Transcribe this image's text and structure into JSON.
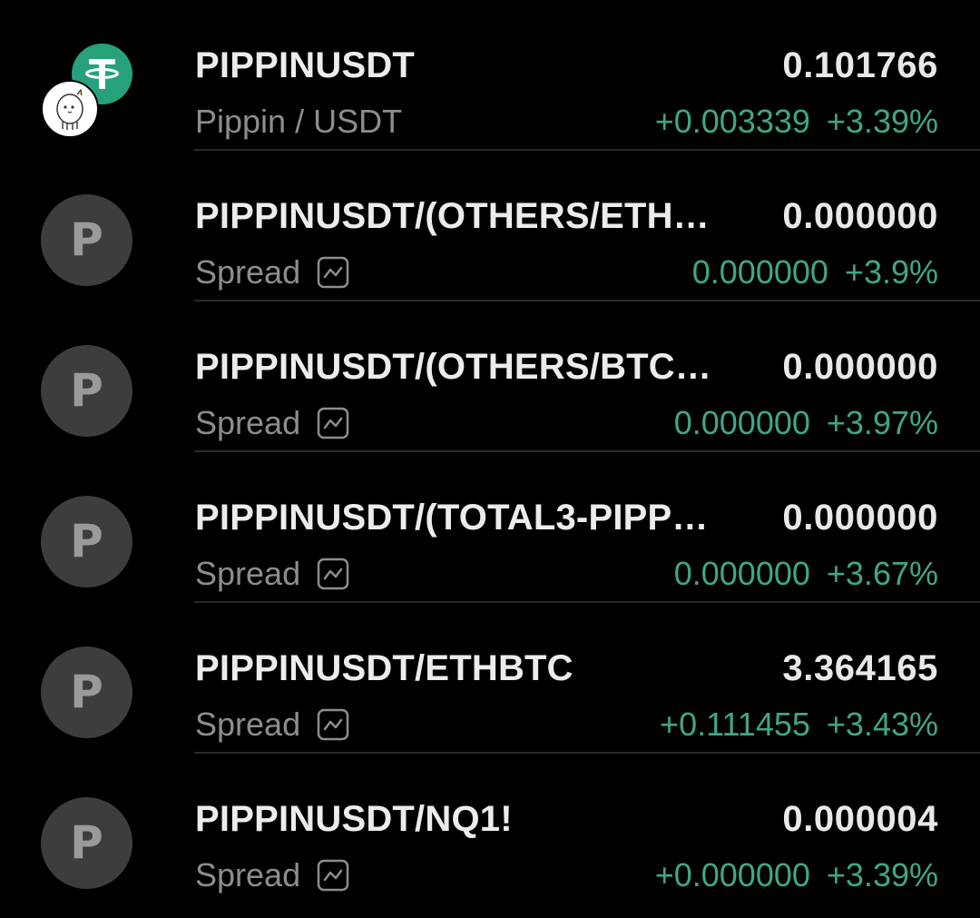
{
  "watchlist": {
    "rows": [
      {
        "symbol": "PIPPINUSDT",
        "subtitle": "Pippin / USDT",
        "price": "0.101766",
        "change": "+0.003339",
        "change_pct": "+3.39%",
        "avatar": {
          "type": "logos",
          "icons": [
            "tether-icon",
            "pippin-icon"
          ]
        }
      },
      {
        "symbol": "PIPPINUSDT/(OTHERS/ETH…",
        "subtitle": "Spread",
        "price": "0.000000",
        "change": "0.000000",
        "change_pct": "+3.9%",
        "avatar": {
          "type": "letter",
          "letter": "P"
        }
      },
      {
        "symbol": "PIPPINUSDT/(OTHERS/BTC…",
        "subtitle": "Spread",
        "price": "0.000000",
        "change": "0.000000",
        "change_pct": "+3.97%",
        "avatar": {
          "type": "letter",
          "letter": "P"
        }
      },
      {
        "symbol": "PIPPINUSDT/(TOTAL3-PIPP…",
        "subtitle": "Spread",
        "price": "0.000000",
        "change": "0.000000",
        "change_pct": "+3.67%",
        "avatar": {
          "type": "letter",
          "letter": "P"
        }
      },
      {
        "symbol": "PIPPINUSDT/ETHBTC",
        "subtitle": "Spread",
        "price": "3.364165",
        "change": "+0.111455",
        "change_pct": "+3.43%",
        "avatar": {
          "type": "letter",
          "letter": "P"
        }
      },
      {
        "symbol": "PIPPINUSDT/NQ1!",
        "subtitle": "Spread",
        "price": "0.000004",
        "change": "+0.000000",
        "change_pct": "+3.39%",
        "avatar": {
          "type": "letter",
          "letter": "P"
        }
      }
    ]
  },
  "colors": {
    "background": "#000000",
    "positive": "#3fa68a",
    "tether": "#26a17b",
    "avatar_bg": "#3d3d3d"
  }
}
